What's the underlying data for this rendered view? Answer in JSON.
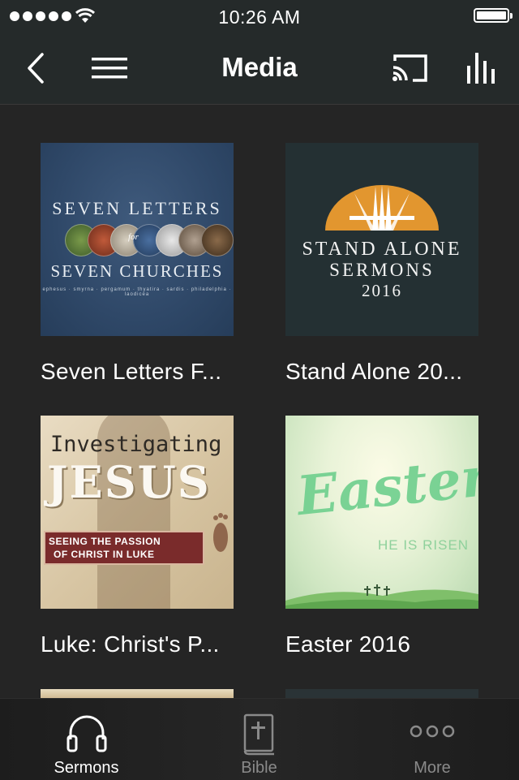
{
  "status_bar": {
    "time": "10:26 AM",
    "signal_icon": "signal-dots-icon",
    "wifi_icon": "wifi-icon",
    "battery_icon": "battery-icon"
  },
  "nav": {
    "title": "Media",
    "back_icon": "chevron-left-icon",
    "menu_icon": "hamburger-menu-icon",
    "cast_icon": "cast-icon",
    "audio_icon": "audio-bars-icon"
  },
  "media_items": [
    {
      "label": "Seven Letters F...",
      "art": {
        "line1": "SEVEN LETTERS",
        "connector": "for",
        "line2": "SEVEN CHURCHES",
        "line3": "ephesus · smyrna · pergamum · thyatira · sardis · philadelphia · laodicea"
      }
    },
    {
      "label": "Stand Alone 20...",
      "art": {
        "line1": "STAND ALONE",
        "line2": "SERMONS",
        "line3": "2016"
      }
    },
    {
      "label": "Luke: Christ's P...",
      "art": {
        "line1": "Investigating",
        "line2": "JESUS",
        "banner1": "SEEING THE PASSION",
        "banner2": "OF CHRIST IN LUKE"
      }
    },
    {
      "label": "Easter 2016",
      "art": {
        "line1": "Easter",
        "line2": "HE IS RISEN"
      }
    }
  ],
  "tabs": [
    {
      "label": "Sermons",
      "icon": "headphones-icon",
      "active": true
    },
    {
      "label": "Bible",
      "icon": "bible-icon",
      "active": false
    },
    {
      "label": "More",
      "icon": "more-dots-icon",
      "active": false
    }
  ],
  "colors": {
    "background": "#252525",
    "bar": "#252a2a",
    "tab_active": "#ffffff",
    "tab_inactive": "#8a8a8a"
  }
}
